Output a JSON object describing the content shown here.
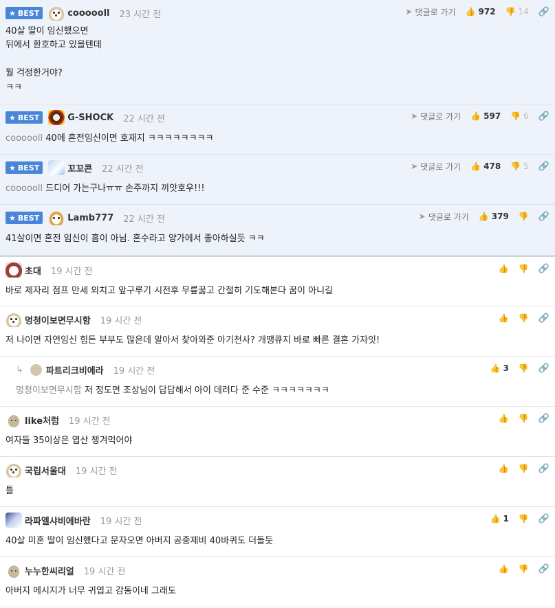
{
  "ui": {
    "best_label": "BEST",
    "reply_label": "댓글로 가기"
  },
  "comments": [
    {
      "nick": "coooooll",
      "time": "23 시간 전",
      "text": "40살 딸이 임신했으면\n뒤에서 환호하고 있을텐데\n\n뭘 걱정한거야?\nㅋㅋ",
      "up": "972",
      "down": "14"
    },
    {
      "nick": "G-SHOCK",
      "time": "22 시간 전",
      "mention": "coooooll",
      "text": "40에 혼전임신이면 호재지 ㅋㅋㅋㅋㅋㅋㅋㅋ",
      "up": "597",
      "down": "6"
    },
    {
      "nick": "꼬꼬콘",
      "time": "22 시간 전",
      "mention": "coooooll",
      "text": "드디어 가는구나ㅠㅠ 손주까지 끼얏호우!!!",
      "up": "478",
      "down": "5"
    },
    {
      "nick": "Lamb777",
      "time": "22 시간 전",
      "text": "41살이면 혼전 임신이 흠이 아님. 혼수라고 양가에서 좋아하실듯 ㅋㅋ",
      "up": "379",
      "down": ""
    },
    {
      "nick": "초대",
      "time": "19 시간 전",
      "text": "바로 제자리 점프 만세 외치고 앞구루기 시전후 무릎꿇고 간절히 기도해본다 꿈이 아니길"
    },
    {
      "nick": "멍청이보면무시함",
      "time": "19 시간 전",
      "text": "저 나이면 자연임신 힘든 부부도 많은데 알아서 찾아와준 아기천사? 개땡큐지 바로 빠른 결혼 가자잇!"
    },
    {
      "nick": "파트리크비에라",
      "time": "19 시간 전",
      "mention": "멍청이보면무시함",
      "text": "저 정도면 조상님이 답답해서 아이 데려다 준 수준 ㅋㅋㅋㅋㅋㅋㅋ",
      "up": "3"
    },
    {
      "nick": "like처럼",
      "time": "19 시간 전",
      "text": "여자들 35이상은 엽산 챙겨먹어야"
    },
    {
      "nick": "국립서울대",
      "time": "19 시간 전",
      "text": "틀"
    },
    {
      "nick": "라파엘샤비에바란",
      "time": "19 시간 전",
      "text": "40살 미혼 딸이 임신했다고 문자오면 아버지 공중제비 40바퀴도 더돌듯",
      "up": "1"
    },
    {
      "nick": "누누한씨리얼",
      "time": "19 시간 전",
      "text": "아버지 메시지가 너무 귀엽고 감동이네 그래도"
    }
  ],
  "icons": {
    "star": "star-icon",
    "reply": "paper-plane-icon",
    "like": "thumbs-up-icon",
    "dislike": "thumbs-down-icon",
    "link": "link-icon",
    "reply_arrow": "reply-arrow-icon"
  },
  "colors": {
    "best_bg": "#eef3fb",
    "badge": "#4a86d8",
    "time": "#999999",
    "mention": "#888888"
  }
}
